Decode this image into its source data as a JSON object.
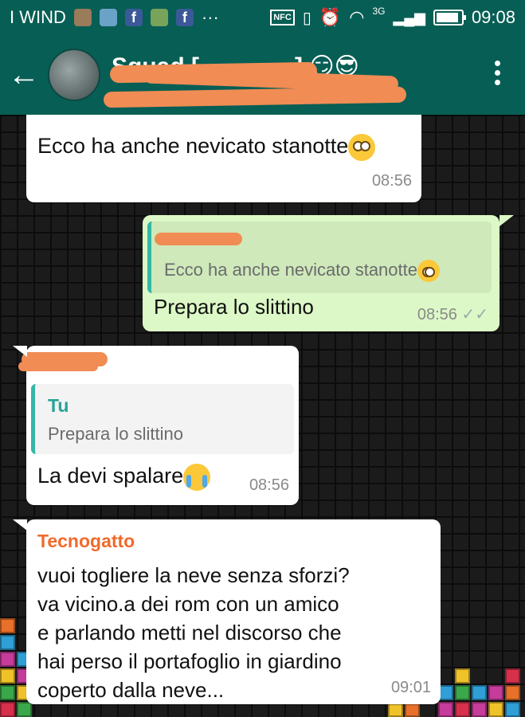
{
  "status_bar": {
    "carrier": "I WIND",
    "nfc": "NFC",
    "network": "3G",
    "time": "09:08",
    "battery_level": 0.9,
    "overflow": "···"
  },
  "header": {
    "title": "Squad [",
    "title_suffix": "] 😏😎",
    "back_icon": "arrow-left-icon",
    "menu_icon": "more-vert-icon"
  },
  "messages": [
    {
      "direction": "in",
      "text": "Ecco ha anche nevicato stanotte",
      "emoji": "face-with-rolling-eyes",
      "time": "08:56"
    },
    {
      "direction": "out",
      "quote_text": "Ecco ha anche nevicato stanotte",
      "text": "Prepara lo slittino",
      "time": "08:56",
      "status": "✓✓"
    },
    {
      "direction": "in",
      "quote_author": "Tu",
      "quote_text": "Prepara lo slittino",
      "text": "La devi spalare",
      "emoji": "loudly-crying-face",
      "time": "08:56"
    },
    {
      "direction": "in",
      "sender": "Tecnogatto",
      "lines": [
        "vuoi togliere la neve senza sforzi?",
        "va vicino.a dei rom con un amico",
        "e parlando metti nel discorso che",
        "hai perso il portafoglio in giardino",
        "coperto dalla neve..."
      ],
      "time": "09:01"
    }
  ],
  "colors": {
    "header": "#075e54",
    "incoming": "#ffffff",
    "outgoing": "#dcf8c6",
    "quote_bar": "#34b7a7",
    "sender_name": "#f06a2c",
    "redaction": "#f08c54"
  }
}
